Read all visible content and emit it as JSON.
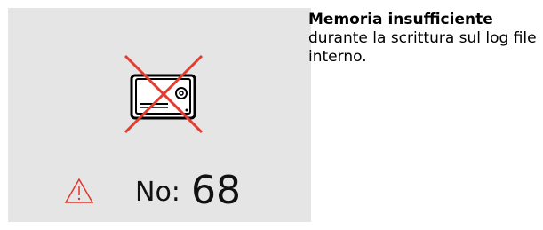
{
  "error": {
    "icon": "memory-storage-error-icon",
    "warning_icon": "warning-triangle-icon",
    "number_label": "No:",
    "number_value": "68",
    "warning_color": "#e0362b",
    "cross_color": "#e53a2f"
  },
  "message": {
    "title": "Memoria insufficiente",
    "body": "durante la scrittura sul log file interno."
  }
}
